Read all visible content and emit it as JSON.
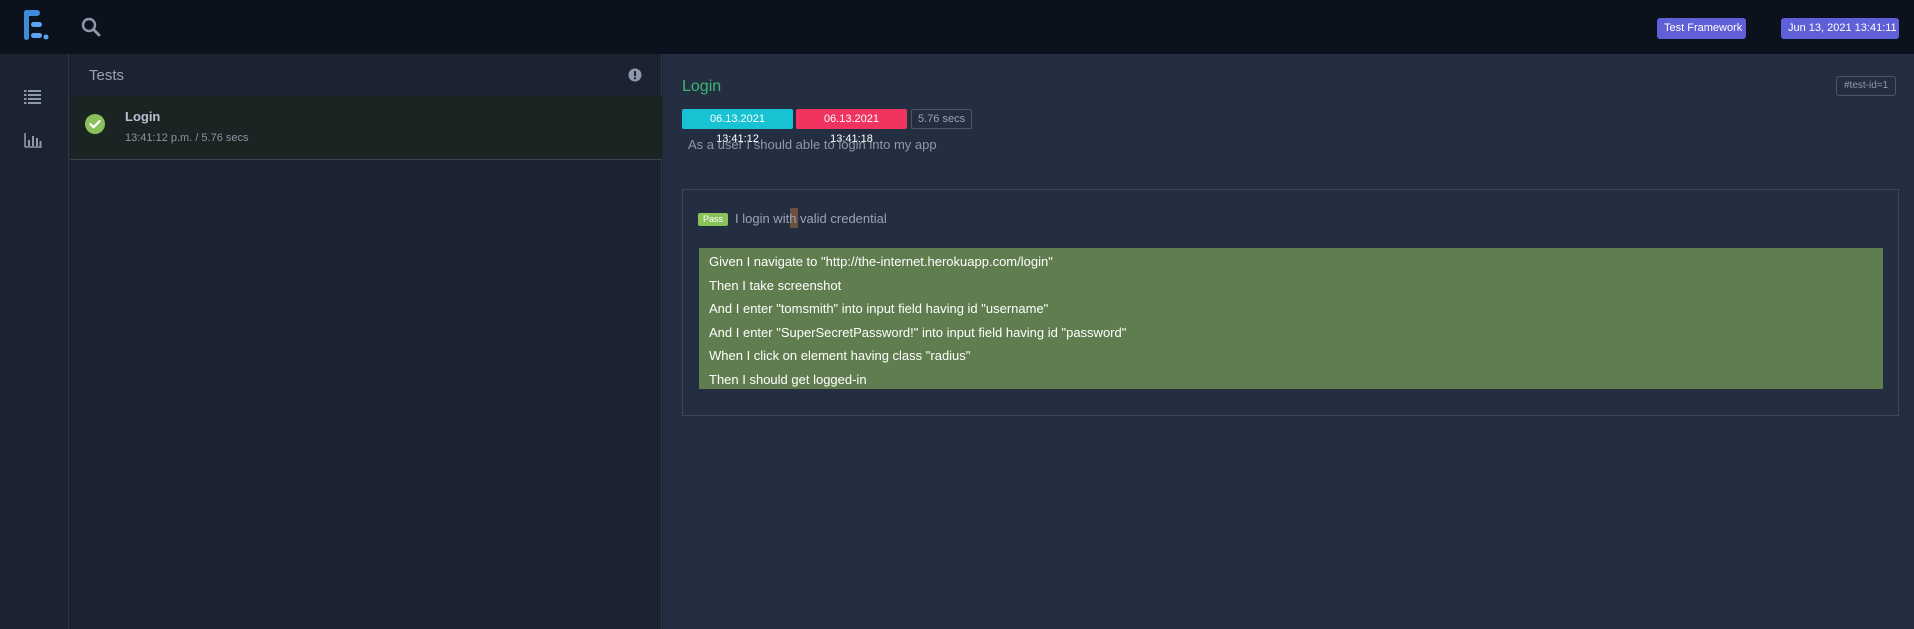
{
  "topbar": {
    "logo_icon": "extent-logo-icon",
    "search_icon": "search-icon",
    "framework_badge": "Test Framework",
    "date_badge": "Jun 13, 2021 13:41:11",
    "badge_color": "#5f5fd8"
  },
  "nav": {
    "items": [
      {
        "icon": "list-icon"
      },
      {
        "icon": "bar-chart-icon"
      }
    ]
  },
  "tests": {
    "title": "Tests",
    "info_icon": "info-icon",
    "items": [
      {
        "name": "Login",
        "meta": "13:41:12 p.m. / 5.76 secs",
        "status": "pass",
        "status_color": "#8ac15b"
      }
    ]
  },
  "detail": {
    "title": "Login",
    "test_id": "#test-id=1",
    "start_time": "06.13.2021 13:41:12",
    "end_time": "06.13.2021 13:41:18",
    "duration": "5.76 secs",
    "description": "As a user I should able to login into my app",
    "title_color": "#3fb47a",
    "start_color": "#17c3d2",
    "end_color": "#f0335f",
    "scenario": {
      "status": "Pass",
      "name": "I login with valid credential",
      "steps": [
        "Given I navigate to \"http://the-internet.herokuapp.com/login\"",
        "Then I take screenshot",
        "And I enter \"tomsmith\" into input field having id \"username\"",
        "And I enter \"SuperSecretPassword!\" into input field having id \"password\"",
        "When I click on element having class \"radius\"",
        "Then I should get logged-in"
      ],
      "steps_color": "#5f7d4f"
    }
  }
}
